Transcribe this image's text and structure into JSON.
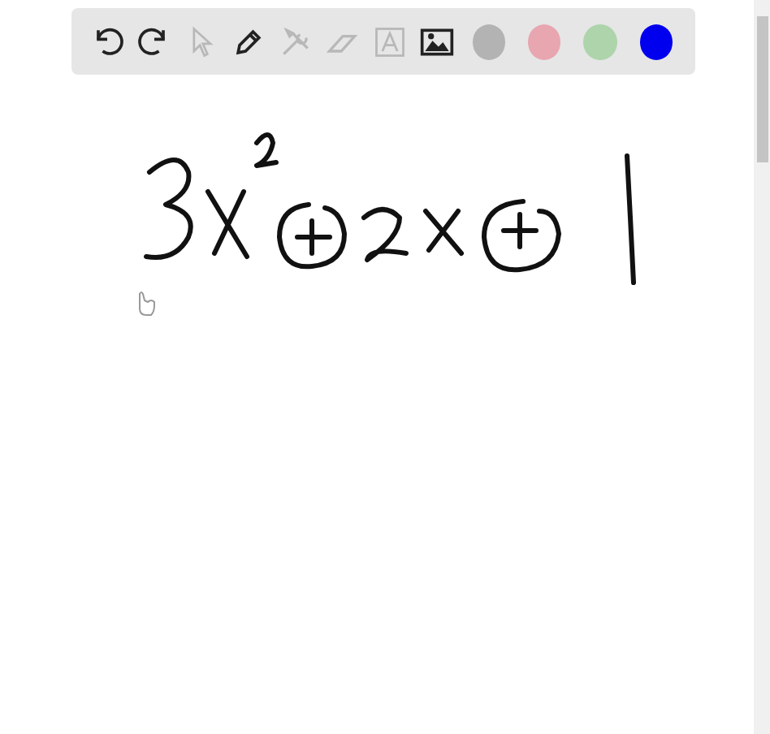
{
  "toolbar": {
    "tools": [
      {
        "kind": "undo",
        "disabled": false
      },
      {
        "kind": "redo",
        "disabled": false
      },
      {
        "kind": "pointer",
        "disabled": true
      },
      {
        "kind": "pen",
        "disabled": false
      },
      {
        "kind": "tools",
        "disabled": true
      },
      {
        "kind": "eraser",
        "disabled": true
      },
      {
        "kind": "text",
        "disabled": true
      },
      {
        "kind": "image",
        "disabled": false
      }
    ],
    "colors": [
      {
        "color": "#b3b3b3"
      },
      {
        "color": "#e8a6b0"
      },
      {
        "color": "#aed4ab"
      },
      {
        "color": "#0000ee"
      }
    ]
  }
}
